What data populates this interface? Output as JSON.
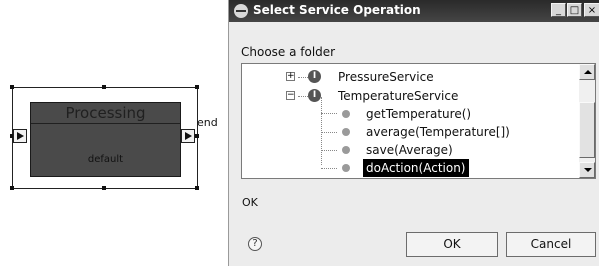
{
  "diagram": {
    "node_title": "Processing",
    "node_label": "default",
    "port_label": "end"
  },
  "dialog": {
    "title": "Select Service Operation",
    "window_buttons": {
      "minimize": "_",
      "maximize": "□",
      "close": "×"
    },
    "prompt": "Choose a folder",
    "tree": {
      "services": [
        {
          "label": "PressureService",
          "expanded": false,
          "expander": "+"
        },
        {
          "label": "TemperatureService",
          "expanded": true,
          "expander": "−"
        }
      ],
      "operations": [
        {
          "label": "getTemperature()"
        },
        {
          "label": "average(Temperature[])"
        },
        {
          "label": "save(Average)"
        },
        {
          "label": "doAction(Action)",
          "selected": true
        }
      ]
    },
    "status": "OK",
    "help_glyph": "?",
    "ok_label": "OK",
    "cancel_label": "Cancel"
  },
  "icons": {
    "title": "dialog-app-icon",
    "service": "service-interface-icon",
    "operation": "operation-icon",
    "help": "help-icon"
  }
}
